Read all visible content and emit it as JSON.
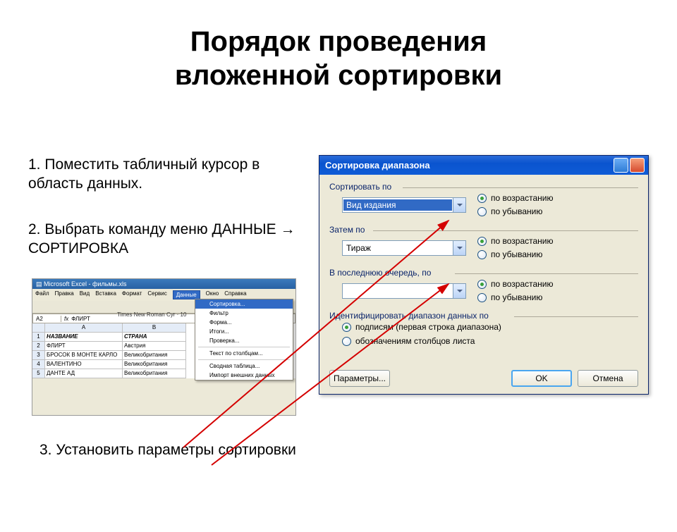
{
  "title_line1": "Порядок проведения",
  "title_line2": "вложенной сортировки",
  "steps": {
    "s1": "1. Поместить табличный курсор в область данных.",
    "s2": "2. Выбрать команду меню ДАННЫЕ → СОРТИРОВКА",
    "s3": "3. Установить параметры сортировки"
  },
  "excel": {
    "title": "Microsoft Excel - фильмы.xls",
    "menus": [
      "Файл",
      "Правка",
      "Вид",
      "Вставка",
      "Формат",
      "Сервис",
      "Данные",
      "Окно",
      "Справка"
    ],
    "font_label": "Times New Roman Cyr  ·  10",
    "cellref": "A2",
    "fx_val": "ФЛИРТ",
    "col_a": "A",
    "col_b": "B",
    "headers": {
      "a": "НАЗВАНИЕ",
      "b": "СТРАНА"
    },
    "rows": [
      {
        "n": "1"
      },
      {
        "n": "2",
        "a": "ФЛИРТ",
        "b": "Австрия"
      },
      {
        "n": "3",
        "a": "БРОСОК В МОНТЕ КАРЛО",
        "b": "Великобритания"
      },
      {
        "n": "4",
        "a": "ВАЛЕНТИНО",
        "b": "Великобритания"
      },
      {
        "n": "5",
        "a": "ДАНТЕ АД",
        "b": "Великобритания"
      }
    ],
    "dropdown": {
      "items": [
        "Сортировка...",
        "Фильтр",
        "Форма...",
        "Итоги...",
        "Проверка...",
        "Текст по столбцам...",
        "Сводная таблица...",
        "Импорт внешних данных"
      ],
      "selected": "Сортировка..."
    }
  },
  "dialog": {
    "title": "Сортировка диапазона",
    "group1": "Сортировать по",
    "combo1": "Вид издания",
    "asc": "по возрастанию",
    "desc": "по убыванию",
    "group2": "Затем по",
    "combo2": "Тираж",
    "group3": "В последнюю очередь, по",
    "combo3": "",
    "group4": "Идентифицировать диапазон данных по",
    "opt_labels": "подписям (первая строка диапазона)",
    "opt_cols": "обозначениям столбцов листа",
    "btn_params": "Параметры...",
    "btn_ok": "OK",
    "btn_cancel": "Отмена"
  }
}
